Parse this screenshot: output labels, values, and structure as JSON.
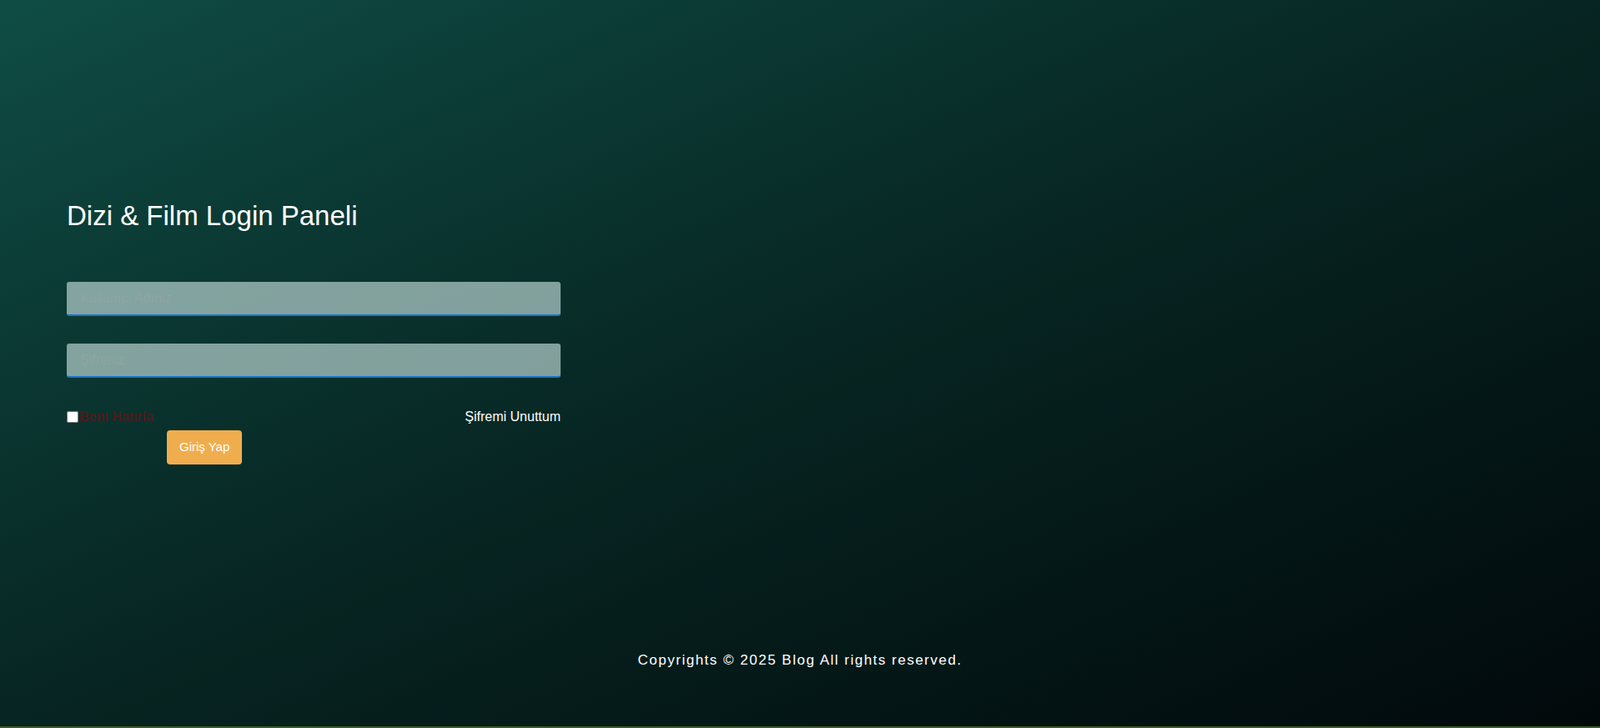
{
  "page": {
    "title": "Dizi & Film Login Paneli"
  },
  "form": {
    "username": {
      "placeholder": "Kullanıcı Adınız",
      "value": ""
    },
    "password": {
      "placeholder": "Şifreniz",
      "value": ""
    },
    "remember": {
      "label": "Beni Hatırla",
      "checked": false
    },
    "forgot": "Şifremi Unuttum",
    "submit": "Giriş Yap"
  },
  "footer": "Copyrights © 2025 Blog All rights reserved."
}
